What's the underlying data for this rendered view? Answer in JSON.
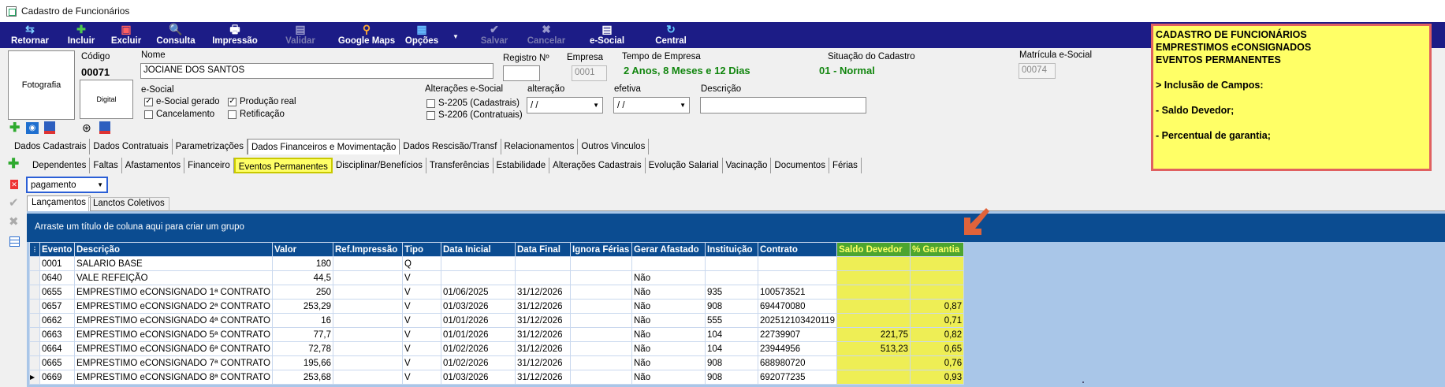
{
  "window": {
    "title": "Cadastro de Funcionários"
  },
  "toolbar": [
    {
      "label": "Retornar",
      "icon": "return-icon",
      "glyph": "⇆",
      "color": "#7fd0ff",
      "enabled": true
    },
    {
      "label": "Incluir",
      "icon": "plus-icon",
      "glyph": "✚",
      "color": "#4ec84e",
      "enabled": true
    },
    {
      "label": "Excluir",
      "icon": "delete-icon",
      "glyph": "▣",
      "color": "#ff6060",
      "enabled": true
    },
    {
      "label": "Consulta",
      "icon": "search-icon",
      "glyph": "🔍",
      "color": "#ffffff",
      "enabled": true
    },
    {
      "label": "Impressão",
      "icon": "printer-icon",
      "glyph": "🖶",
      "color": "#ffffff",
      "enabled": true
    },
    {
      "label": "Validar",
      "icon": "validate-icon",
      "glyph": "▤",
      "color": "#9999cc",
      "enabled": false
    },
    {
      "label": "Google Maps",
      "icon": "map-pin-icon",
      "glyph": "⚲",
      "color": "#ffaa33",
      "enabled": true
    },
    {
      "label": "Opções",
      "icon": "options-icon",
      "glyph": "▦",
      "color": "#66bbff",
      "enabled": true
    },
    {
      "label": "Salvar",
      "icon": "check-icon",
      "glyph": "✔",
      "color": "#9999cc",
      "enabled": false
    },
    {
      "label": "Cancelar",
      "icon": "cancel-icon",
      "glyph": "✖",
      "color": "#9999cc",
      "enabled": false
    },
    {
      "label": "e-Social",
      "icon": "document-icon",
      "glyph": "▤",
      "color": "#ffffff",
      "enabled": true
    },
    {
      "label": "Central",
      "icon": "refresh-icon",
      "glyph": "↻",
      "color": "#66ccff",
      "enabled": true
    }
  ],
  "info_box": {
    "lines": [
      "CADASTRO DE FUNCIONÁRIOS",
      "EMPRESTIMOS eCONSIGNADOS",
      "EVENTOS PERMANENTES",
      "",
      "> Inclusão de Campos:",
      "",
      "- Saldo Devedor;",
      "",
      "- Percentual de garantia;"
    ]
  },
  "employee": {
    "photo_label": "Fotografia",
    "digital_label": "Digital",
    "codigo_label": "Código",
    "codigo": "00071",
    "nome_label": "Nome",
    "nome": "JOCIANE DOS SANTOS",
    "registro_label": "Registro Nº",
    "registro": "",
    "empresa_label": "Empresa",
    "empresa": "0001",
    "tempo_label": "Tempo de Empresa",
    "tempo": "2 Anos, 8 Meses  e 12 Dias",
    "situacao_label": "Situação do Cadastro",
    "situacao": "01 - Normal",
    "matricula_label": "Matrícula e-Social",
    "matricula": "00074"
  },
  "esocial": {
    "label": "e-Social",
    "gerado": {
      "label": "e-Social gerado",
      "checked": true
    },
    "producao": {
      "label": "Produção real",
      "checked": true
    },
    "cancelamento": {
      "label": "Cancelamento",
      "checked": false
    },
    "retificacao": {
      "label": "Retificação",
      "checked": false
    }
  },
  "alteracoes": {
    "label": "Alterações e-Social",
    "s2205": {
      "label": "S-2205 (Cadastrais)",
      "checked": false
    },
    "s2206": {
      "label": "S-2206 (Contratuais)",
      "checked": false
    },
    "alteracao_label": "alteração",
    "alteracao": " / /",
    "efetiva_label": "efetiva",
    "efetiva": " / /",
    "descricao_label": "Descrição",
    "descricao": ""
  },
  "tabs_main": [
    "Dados Cadastrais",
    "Dados Contratuais",
    "Parametrizações",
    "Dados Financeiros e Movimentação",
    "Dados Rescisão/Transf",
    "Relacionamentos",
    "Outros Vinculos"
  ],
  "tabs_main_active": 3,
  "tabs_sub": [
    "Dependentes",
    "Faltas",
    "Afastamentos",
    "Financeiro",
    "Eventos Permanentes",
    "Disciplinar/Benefícios",
    "Transferências",
    "Estabilidade",
    "Alterações Cadastrais",
    "Evolução Salarial",
    "Vacinação",
    "Documentos",
    "Férias"
  ],
  "tabs_sub_active": 4,
  "filter_value": "pagamento",
  "tabs_inner": [
    "Lançamentos",
    "Lanctos Coletivos"
  ],
  "group_hint": "Arraste um título de coluna aqui para criar um grupo",
  "grid": {
    "corner": "⋮",
    "columns": [
      "Evento",
      "Descrição",
      "Valor",
      "Ref.Impressão",
      "Tipo",
      "Data Inicial",
      "Data Final",
      "Ignora Férias",
      "Gerar Afastado",
      "Instituição",
      "Contrato",
      "Saldo Devedor",
      "% Garantia"
    ],
    "rows": [
      [
        "0001",
        "SALARIO BASE",
        "180",
        "",
        "Q",
        "",
        "",
        "",
        "",
        "",
        "",
        "",
        ""
      ],
      [
        "0640",
        "VALE REFEIÇÃO",
        "44,5",
        "",
        "V",
        "",
        "",
        "",
        "Não",
        "",
        "",
        "",
        ""
      ],
      [
        "0655",
        "EMPRESTIMO eCONSIGNADO 1ª CONTRATO",
        "250",
        "",
        "V",
        "01/06/2025",
        "31/12/2026",
        "",
        "Não",
        "935",
        "100573521",
        "",
        ""
      ],
      [
        "0657",
        "EMPRESTIMO eCONSIGNADO 2ª CONTRATO",
        "253,29",
        "",
        "V",
        "01/03/2026",
        "31/12/2026",
        "",
        "Não",
        "908",
        "694470080",
        "",
        "0,87"
      ],
      [
        "0662",
        "EMPRESTIMO eCONSIGNADO 4ª CONTRATO",
        "16",
        "",
        "V",
        "01/01/2026",
        "31/12/2026",
        "",
        "Não",
        "555",
        "202512103420119",
        "",
        "0,71"
      ],
      [
        "0663",
        "EMPRESTIMO eCONSIGNADO 5ª CONTRATO",
        "77,7",
        "",
        "V",
        "01/01/2026",
        "31/12/2026",
        "",
        "Não",
        "104",
        "22739907",
        "221,75",
        "0,82"
      ],
      [
        "0664",
        "EMPRESTIMO eCONSIGNADO 6ª CONTRATO",
        "72,78",
        "",
        "V",
        "01/02/2026",
        "31/12/2026",
        "",
        "Não",
        "104",
        "23944956",
        "513,23",
        "0,65"
      ],
      [
        "0665",
        "EMPRESTIMO eCONSIGNADO 7ª CONTRATO",
        "195,66",
        "",
        "V",
        "01/02/2026",
        "31/12/2026",
        "",
        "Não",
        "908",
        "688980720",
        "",
        "0,76"
      ],
      [
        "0669",
        "EMPRESTIMO eCONSIGNADO 8ª CONTRATO",
        "253,68",
        "",
        "V",
        "01/03/2026",
        "31/12/2026",
        "",
        "Não",
        "908",
        "692077235",
        "",
        "0,93"
      ]
    ],
    "current_row": 8,
    "highlight_color": "#eeee55"
  }
}
